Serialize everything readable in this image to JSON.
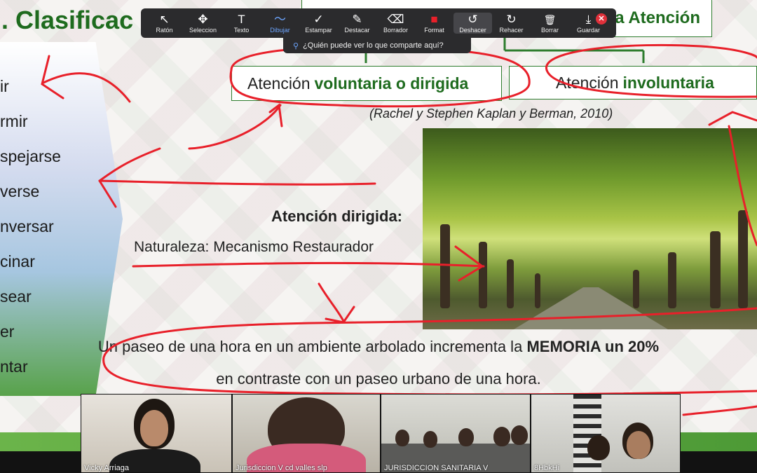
{
  "slide": {
    "title": ". Clasificac",
    "top_box_label": "a Atención",
    "left_verbs": [
      "ir",
      "rmir",
      "spejarse",
      "verse",
      "nversar",
      "cinar",
      "sear",
      "er",
      "ntar"
    ],
    "box_voluntary": {
      "text": "Atención",
      "emph": "voluntaria o dirigida"
    },
    "box_involuntary": {
      "text": "Atención",
      "emph": "involuntaria"
    },
    "citation": "(Rachel y Stephen Kaplan y Berman, 2010)",
    "directed_heading": "Atención dirigida:",
    "nature_text": "Naturaleza: Mecanismo Restaurador",
    "statement_line1_pre": "Un paseo de una hora en un ambiente arbolado incrementa la",
    "statement_line1_bold": "MEMORIA un 20%",
    "statement_line2": "en contraste con un paseo urbano de una hora."
  },
  "toolbar": {
    "tools": [
      {
        "label": "Ratón",
        "icon": "↖"
      },
      {
        "label": "Seleccion",
        "icon": "✥"
      },
      {
        "label": "Texto",
        "icon": "T"
      },
      {
        "label": "Dibujar",
        "icon": "〜"
      },
      {
        "label": "Estampar",
        "icon": "✓"
      },
      {
        "label": "Destacar",
        "icon": "✎"
      },
      {
        "label": "Borrador",
        "icon": "⌫"
      },
      {
        "label": "Format",
        "icon": "■"
      },
      {
        "label": "Deshacer",
        "icon": "↺"
      },
      {
        "label": "Rehacer",
        "icon": "↻"
      },
      {
        "label": "Borrar",
        "icon": "🗑"
      },
      {
        "label": "Guardar",
        "icon": "⤓"
      }
    ],
    "active_tool": "Dibujar",
    "format_color": "#e8202a",
    "share_notice": "¿Quién puede ver lo que comparte aquí?"
  },
  "participants": [
    {
      "name": "Vicky Arriaga"
    },
    {
      "name": "Jurisdiccion V cd valles slp"
    },
    {
      "name": "JURISDICCION SANITARIA V"
    },
    {
      "name": "8HbkHi"
    }
  ],
  "colors": {
    "slide_green": "#1e6b1e",
    "ink_red": "#e8202a"
  }
}
